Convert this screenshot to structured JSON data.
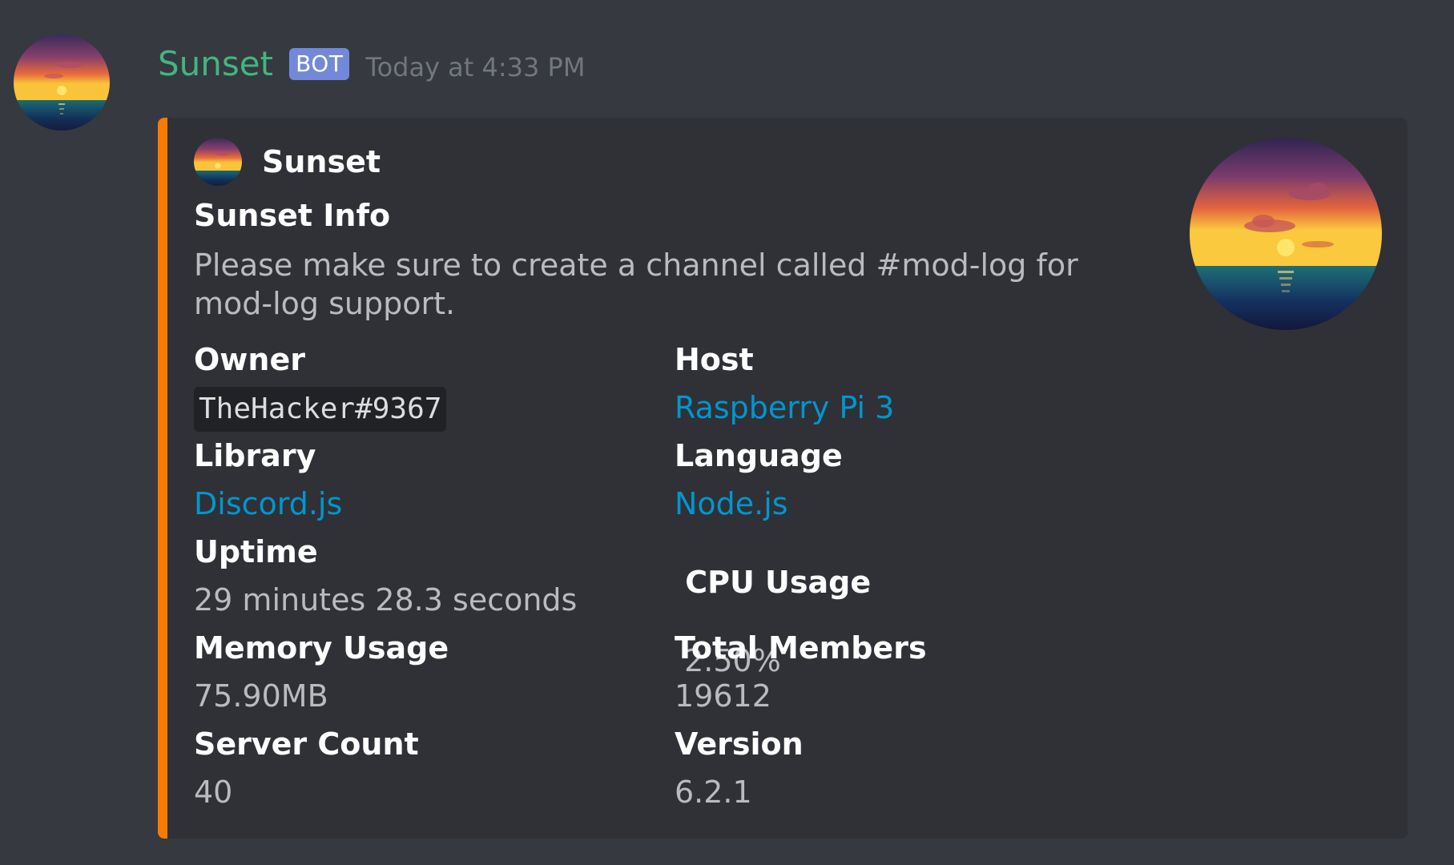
{
  "message": {
    "username": "Sunset",
    "bot_tag": "BOT",
    "timestamp": "Today at 4:33 PM"
  },
  "embed": {
    "color": "#f57c00",
    "author_name": "Sunset",
    "title": "Sunset Info",
    "description": "Please make sure to create a channel called #mod-log for mod-log support.",
    "fields": [
      {
        "name": "Owner",
        "value": "TheHacker#9367",
        "style": "code"
      },
      {
        "name": "Host",
        "value": "Raspberry Pi 3",
        "style": "link"
      },
      {
        "name": "Library",
        "value": "Discord.js",
        "style": "link"
      },
      {
        "name": "Language",
        "value": "Node.js",
        "style": "link"
      },
      {
        "name": "Uptime",
        "value": "29 minutes 28.3 seconds",
        "style": "text"
      },
      {
        "name": " CPU Usage",
        "value": " 2.50%",
        "style": "text"
      },
      {
        "name": "Memory Usage",
        "value": "75.90MB",
        "style": "text"
      },
      {
        "name": "Total Members",
        "value": "19612",
        "style": "text"
      },
      {
        "name": "Server Count",
        "value": "40",
        "style": "text"
      },
      {
        "name": "Version",
        "value": "6.2.1",
        "style": "text"
      }
    ]
  },
  "colors": {
    "background": "#36393f",
    "embed_background": "#2f3136",
    "username": "#43b581",
    "bot_tag": "#7289da",
    "link": "#0096cf"
  }
}
